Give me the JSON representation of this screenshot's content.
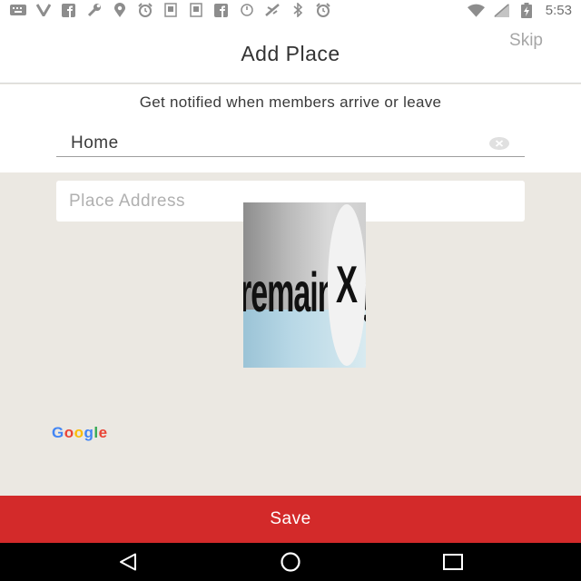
{
  "status_bar": {
    "time": "5:53",
    "icons": [
      "keyboard-icon",
      "vpn-icon",
      "facebook-icon",
      "wrench-icon",
      "location-icon",
      "alarm-icon",
      "sim-icon",
      "sim-icon",
      "facebook-icon",
      "sync-icon",
      "no-signal-icon",
      "bluetooth-icon",
      "alarm-icon",
      "wifi-icon",
      "cell-signal-icon",
      "battery-icon"
    ]
  },
  "header": {
    "title": "Add Place",
    "skip_label": "Skip"
  },
  "form": {
    "subtitle": "Get notified when members arrive or leave",
    "name_value": "Home",
    "address_placeholder": "Place Address"
  },
  "ad_overlay": {
    "text": "remaining",
    "close_glyph": "X"
  },
  "map": {
    "attribution": [
      "G",
      "o",
      "o",
      "g",
      "l",
      "e"
    ],
    "attribution_colors": [
      "#4285F4",
      "#EA4335",
      "#FBBC05",
      "#4285F4",
      "#34A853",
      "#EA4335"
    ]
  },
  "save_button": {
    "label": "Save",
    "color": "#d32a2a"
  },
  "nav_bar": {
    "buttons": [
      "back-icon",
      "home-icon",
      "recents-icon"
    ]
  }
}
